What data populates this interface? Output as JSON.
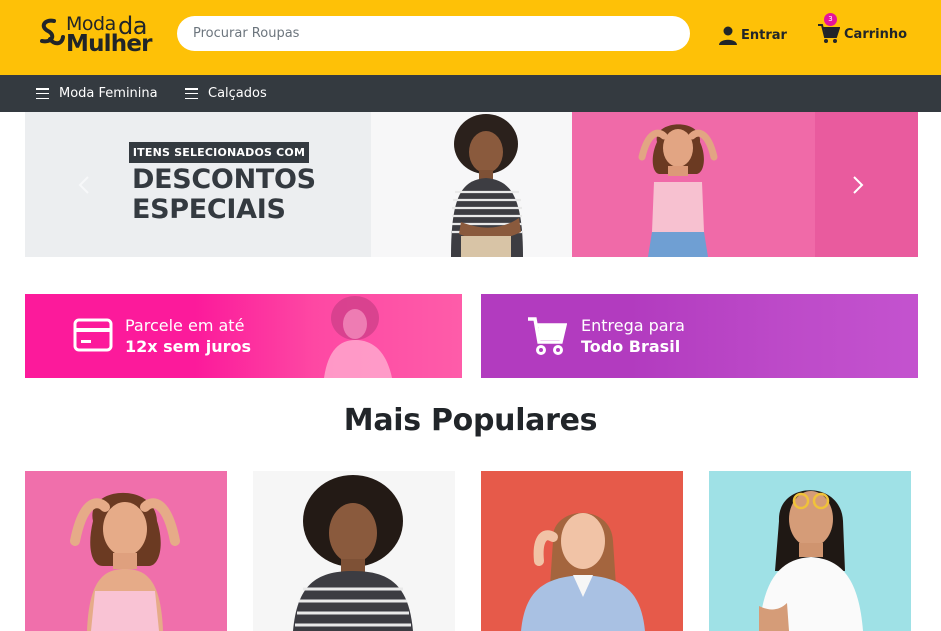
{
  "brand": {
    "logo_line1_a": "Moda",
    "logo_line1_b": "da",
    "logo_line2": "Mulher"
  },
  "header": {
    "search_placeholder": "Procurar Roupas",
    "login_label": "Entrar",
    "cart_label": "Carrinho",
    "cart_count": "3",
    "accent_color": "#fec107",
    "badge_color": "#e6149b"
  },
  "nav": {
    "items": [
      {
        "label": "Moda Feminina",
        "icon": "menu-icon"
      },
      {
        "label": "Calçados",
        "icon": "menu-icon"
      }
    ]
  },
  "carousel": {
    "chip_text": "ITENS SELECIONADOS COM",
    "headline_line1": "DESCONTOS",
    "headline_line2": "ESPECIAIS",
    "prev_icon": "chevron-left-icon",
    "next_icon": "chevron-right-icon"
  },
  "banners": [
    {
      "line1": "Parcele em até",
      "line2": "12x sem juros",
      "icon": "credit-card-icon",
      "color": "#fc1a9b"
    },
    {
      "line1": "Entrega para",
      "line2": "Todo Brasil",
      "icon": "shopping-cart-icon",
      "color": "#b23bbf"
    }
  ],
  "popular": {
    "title": "Mais Populares",
    "products": [
      {
        "image": "woman-pink-top-photo"
      },
      {
        "image": "woman-striped-shirt-photo"
      },
      {
        "image": "woman-denim-shirt-photo"
      },
      {
        "image": "woman-white-top-sunglasses-photo"
      }
    ]
  }
}
